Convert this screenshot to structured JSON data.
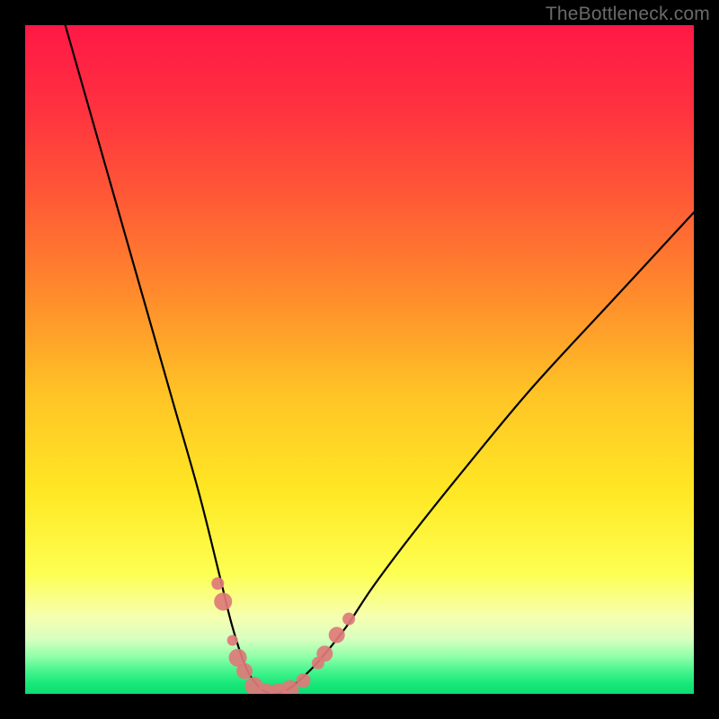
{
  "watermark": {
    "text": "TheBottleneck.com"
  },
  "gradient": {
    "stops": [
      {
        "offset": 0.0,
        "color": "#ff1846"
      },
      {
        "offset": 0.12,
        "color": "#ff3040"
      },
      {
        "offset": 0.26,
        "color": "#ff5a36"
      },
      {
        "offset": 0.4,
        "color": "#ff8a2c"
      },
      {
        "offset": 0.55,
        "color": "#ffc326"
      },
      {
        "offset": 0.7,
        "color": "#ffe824"
      },
      {
        "offset": 0.82,
        "color": "#fdff52"
      },
      {
        "offset": 0.885,
        "color": "#f6ffb0"
      },
      {
        "offset": 0.918,
        "color": "#d8ffbf"
      },
      {
        "offset": 0.945,
        "color": "#8dffa8"
      },
      {
        "offset": 0.965,
        "color": "#49f58f"
      },
      {
        "offset": 0.985,
        "color": "#17e879"
      },
      {
        "offset": 1.0,
        "color": "#0fdc72"
      }
    ]
  },
  "chart_data": {
    "type": "line",
    "title": "",
    "xlabel": "",
    "ylabel": "",
    "xlim": [
      0,
      100
    ],
    "ylim": [
      0,
      100
    ],
    "grid": false,
    "legend": false,
    "series": [
      {
        "name": "bottleneck-curve",
        "x": [
          6,
          10,
          14,
          18,
          22,
          26,
          29,
          31,
          33,
          35,
          37,
          39,
          41,
          44,
          48,
          52,
          58,
          66,
          76,
          88,
          100
        ],
        "y": [
          100,
          86,
          72,
          58,
          44,
          30,
          18,
          10,
          4,
          1,
          0,
          0.5,
          2,
          5,
          10,
          16,
          24,
          34,
          46,
          59,
          72
        ],
        "note": "y is bottleneck percent; minimum ≈0 at x≈37 (the green sweet spot)"
      }
    ],
    "markers": {
      "name": "sweet-spot-markers",
      "color": "#de7a7a",
      "points": [
        {
          "x": 28.8,
          "y": 16.5,
          "r": 7
        },
        {
          "x": 29.6,
          "y": 13.8,
          "r": 10
        },
        {
          "x": 31.0,
          "y": 8.0,
          "r": 6
        },
        {
          "x": 31.8,
          "y": 5.4,
          "r": 10
        },
        {
          "x": 32.8,
          "y": 3.4,
          "r": 9
        },
        {
          "x": 34.2,
          "y": 1.2,
          "r": 10
        },
        {
          "x": 36.0,
          "y": 0.2,
          "r": 10
        },
        {
          "x": 37.8,
          "y": 0.2,
          "r": 10
        },
        {
          "x": 39.6,
          "y": 0.7,
          "r": 10
        },
        {
          "x": 41.6,
          "y": 2.0,
          "r": 8
        },
        {
          "x": 43.8,
          "y": 4.6,
          "r": 7
        },
        {
          "x": 44.8,
          "y": 6.0,
          "r": 9
        },
        {
          "x": 46.6,
          "y": 8.8,
          "r": 9
        },
        {
          "x": 48.4,
          "y": 11.2,
          "r": 7
        }
      ]
    }
  }
}
